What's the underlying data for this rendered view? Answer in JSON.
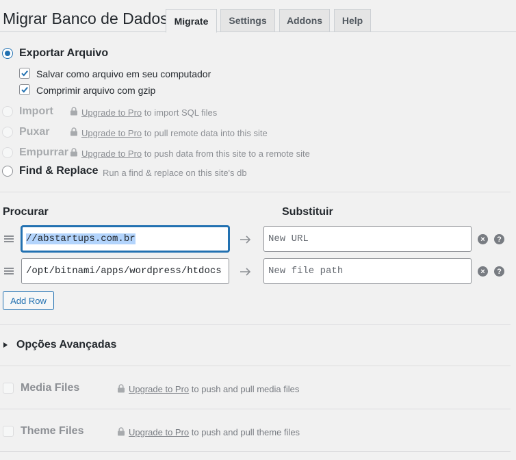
{
  "header": {
    "title": "Migrar Banco de Dados",
    "tabs": [
      {
        "label": "Migrate",
        "active": true
      },
      {
        "label": "Settings",
        "active": false
      },
      {
        "label": "Addons",
        "active": false
      },
      {
        "label": "Help",
        "active": false
      }
    ]
  },
  "actions": {
    "export": {
      "label": "Exportar Arquivo",
      "checked": true,
      "options": [
        {
          "label": "Salvar como arquivo em seu computador",
          "checked": true
        },
        {
          "label": "Comprimir arquivo com gzip",
          "checked": true
        }
      ]
    },
    "import": {
      "label": "Import",
      "link": "Upgrade to Pro",
      "note": " to import SQL files"
    },
    "pull": {
      "label": "Puxar",
      "link": "Upgrade to Pro",
      "note": " to pull remote data into this site"
    },
    "push": {
      "label": "Empurrar",
      "link": "Upgrade to Pro",
      "note": " to push data from this site to a remote site"
    },
    "find_replace": {
      "label": "Find & Replace",
      "hint": "Run a find & replace on this site's db"
    }
  },
  "find_replace": {
    "find_header": "Procurar",
    "replace_header": "Substituir",
    "rows": [
      {
        "find": "//abstartups.com.br",
        "replace_placeholder": "New URL"
      },
      {
        "find": "/opt/bitnami/apps/wordpress/htdocs",
        "replace_placeholder": "New file path"
      }
    ],
    "add_row_label": "Add Row"
  },
  "advanced": {
    "label": "Opções Avançadas"
  },
  "media_files": {
    "label": "Media Files",
    "link": "Upgrade to Pro",
    "note": " to push and pull media files"
  },
  "theme_files": {
    "label": "Theme Files",
    "link": "Upgrade to Pro",
    "note": " to push and pull theme files"
  },
  "colors": {
    "accent": "#2271b1",
    "background": "#f1f1f1",
    "muted": "#8c8f94"
  }
}
